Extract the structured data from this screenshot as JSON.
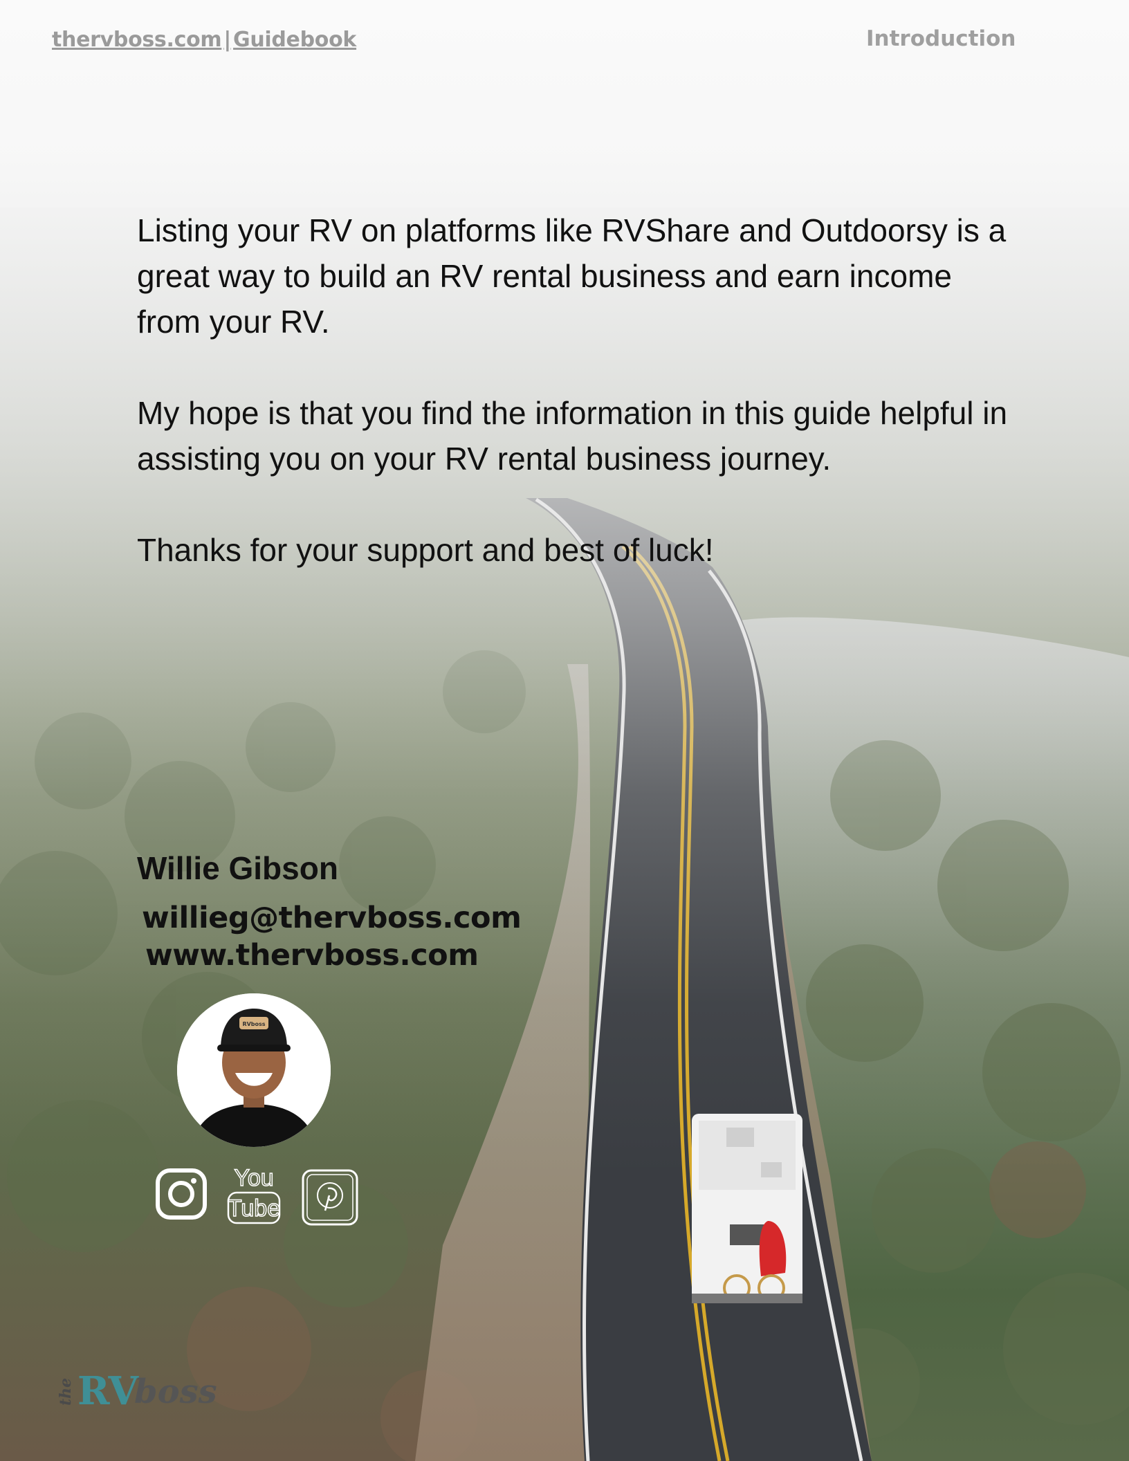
{
  "header": {
    "site": "thervboss.com",
    "separator": "|",
    "guide": "Guidebook",
    "section": "Introduction"
  },
  "body": {
    "paragraph1": "Listing your RV on platforms like RVShare and Outdoorsy is a great way to build an RV rental business and earn income from your RV.",
    "paragraph2": "My hope is that you find the information in this guide helpful in assisting you on your RV rental business journey.",
    "paragraph3": "Thanks for your support and best of luck!"
  },
  "author": {
    "name": "Willie Gibson",
    "email": "willieg@thervboss.com",
    "website": "www.thervboss.com",
    "cap_text": "RVboss"
  },
  "social": {
    "icons": [
      "instagram-icon",
      "youtube-icon",
      "pinterest-icon"
    ],
    "youtube_top": "You",
    "youtube_bottom": "Tube"
  },
  "logo": {
    "the": "the",
    "rv": "RV",
    "boss": "boss"
  },
  "colors": {
    "text": "#111111",
    "header": "#9a9a9a",
    "logo_rv": "#3f8f96",
    "logo_boss": "#555555",
    "road": "#3a3d42",
    "center_line": "#d6a92a"
  }
}
